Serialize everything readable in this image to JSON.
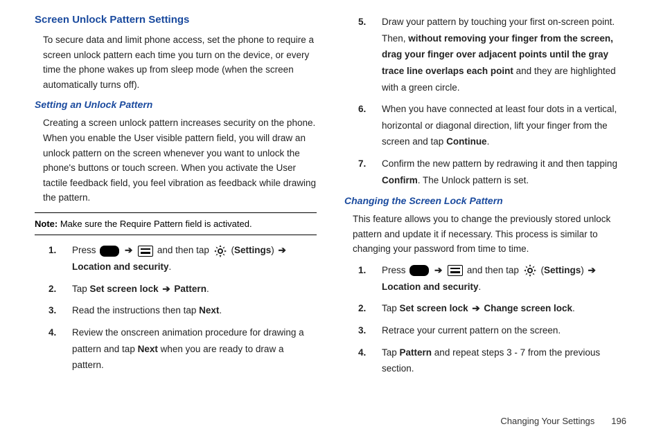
{
  "left": {
    "heading": "Screen Unlock Pattern Settings",
    "intro": "To secure data and limit phone access, set the phone to require a screen unlock pattern each time you turn on the device, or every time the phone wakes up from sleep mode (when the screen automatically turns off).",
    "sub1": "Setting an Unlock Pattern",
    "sub1_para": "Creating a screen unlock pattern increases security on the phone. When you enable the User visible pattern field, you will draw an unlock pattern on the screen whenever you want to unlock the phone's buttons or touch screen. When you activate the User tactile feedback field, you feel vibration as feedback while drawing the pattern.",
    "note_label": "Note:",
    "note_text": " Make sure the Require Pattern field is activated.",
    "steps": {
      "s1_a": "Press ",
      "s1_b": " and then tap ",
      "s1_c": " (",
      "s1_d": "Settings",
      "s1_e": ") ",
      "s1_f": "Location and security",
      "s1_g": ".",
      "s2_a": "Tap ",
      "s2_b": "Set screen lock",
      "s2_c": " Pattern",
      "s2_d": ".",
      "s3_a": "Read the instructions then tap ",
      "s3_b": "Next",
      "s3_c": ".",
      "s4_a": "Review the onscreen animation procedure for drawing a pattern and tap ",
      "s4_b": "Next",
      "s4_c": " when you are ready to draw a pattern."
    }
  },
  "right": {
    "steps_cont": {
      "s5_a": "Draw your pattern by touching your first on-screen point. Then, ",
      "s5_b": "without removing your finger from the screen, drag your finger over adjacent points until the gray trace line overlaps each point",
      "s5_c": " and they are highlighted with a green circle.",
      "s6_a": "When you have connected at least four dots in a vertical, horizontal or diagonal direction, lift your finger from the screen and tap ",
      "s6_b": "Continue",
      "s6_c": ".",
      "s7_a": "Confirm the new pattern by redrawing it and then tapping ",
      "s7_b": "Confirm",
      "s7_c": ". The Unlock pattern is set."
    },
    "sub2": "Changing the Screen Lock Pattern",
    "sub2_para": "This feature allows you to change the previously stored unlock pattern and update it if necessary. This process is similar to changing your password from time to time.",
    "steps2": {
      "s1_a": "Press ",
      "s1_b": " and then tap ",
      "s1_c": " (",
      "s1_d": "Settings",
      "s1_e": ") ",
      "s1_f": "Location and security",
      "s1_g": ".",
      "s2_a": "Tap ",
      "s2_b": "Set screen lock",
      "s2_c": " Change screen lock",
      "s2_d": ".",
      "s3_a": "Retrace your current pattern on the screen.",
      "s4_a": "Tap ",
      "s4_b": "Pattern",
      "s4_c": " and repeat steps 3 - 7 from the previous section."
    }
  },
  "arrow": "➔",
  "footer": {
    "section": "Changing Your Settings",
    "page": "196"
  }
}
